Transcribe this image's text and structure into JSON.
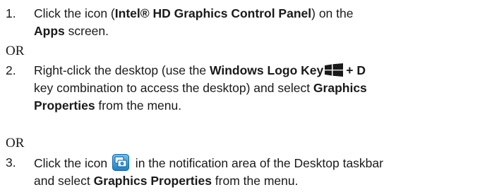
{
  "step1": {
    "number": "1.",
    "text_a": "Click the icon (",
    "bold_a": "Intel® HD Graphics Control Panel",
    "text_b": ") on the",
    "bold_b": "Apps",
    "text_c": " screen."
  },
  "or_1": "OR",
  "step2": {
    "number": "2.",
    "text_a": "Right-click the desktop (use the ",
    "bold_a": "Windows Logo Key",
    "bold_b": "+ D",
    "text_b": "key combination to access the desktop) and select ",
    "bold_c": "Graphics",
    "bold_d": "Properties",
    "text_c": " from the menu.",
    "icon": "windows-logo-icon"
  },
  "or_2": "OR",
  "step3": {
    "number": "3.",
    "text_a": "Click the icon ",
    "text_b": " in the notification area of the Desktop taskbar",
    "text_c": "and select ",
    "bold_a": "Graphics Properties",
    "text_d": " from the menu.",
    "icon": "intel-graphics-tray-icon"
  }
}
